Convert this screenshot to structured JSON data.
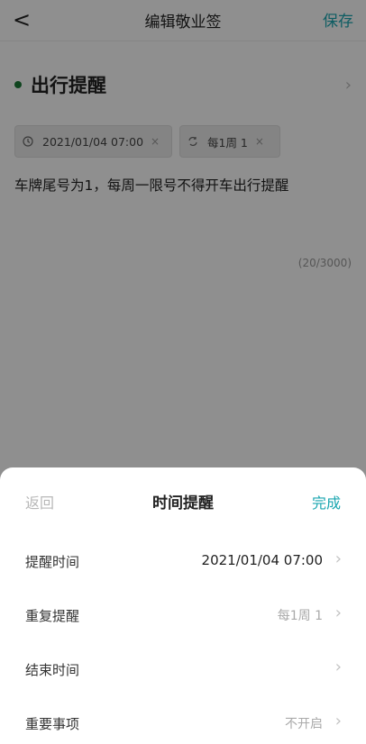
{
  "header": {
    "back_glyph": "<",
    "title": "编辑敬业签",
    "save_label": "保存"
  },
  "category": {
    "label": "出行提醒",
    "dot_color": "#1c7a37",
    "chevron": "›"
  },
  "chips": [
    {
      "icon": "clock-icon",
      "text": "2021/01/04 07:00",
      "close": "×"
    },
    {
      "icon": "repeat-icon",
      "text": "每1周 1",
      "close": "×"
    }
  ],
  "note": {
    "text": "车牌尾号为1，每周一限号不得开车出行提醒",
    "counter": "(20/3000)"
  },
  "sheet": {
    "back_label": "返回",
    "title": "时间提醒",
    "done_label": "完成",
    "rows": [
      {
        "label": "提醒时间",
        "value": "2021/01/04 07:00",
        "chevron": "›"
      },
      {
        "label": "重复提醒",
        "value": "每1周 1",
        "chevron": "›"
      },
      {
        "label": "结束时间",
        "value": "",
        "chevron": "›"
      },
      {
        "label": "重要事项",
        "value": "不开启",
        "chevron": "›"
      }
    ]
  },
  "colors": {
    "accent": "#1aa6b0",
    "overlay": "rgba(0,0,0,0.44)"
  }
}
